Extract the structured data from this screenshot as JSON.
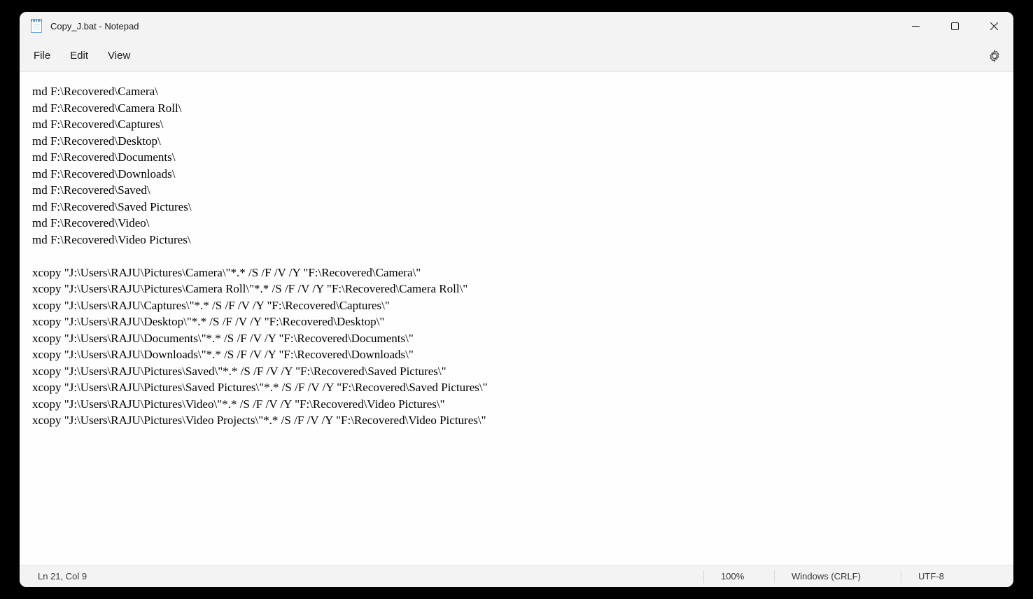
{
  "window": {
    "title": "Copy_J.bat - Notepad"
  },
  "menu": {
    "file": "File",
    "edit": "Edit",
    "view": "View"
  },
  "editor": {
    "content": "md F:\\Recovered\\Camera\\\nmd F:\\Recovered\\Camera Roll\\\nmd F:\\Recovered\\Captures\\\nmd F:\\Recovered\\Desktop\\\nmd F:\\Recovered\\Documents\\\nmd F:\\Recovered\\Downloads\\\nmd F:\\Recovered\\Saved\\\nmd F:\\Recovered\\Saved Pictures\\\nmd F:\\Recovered\\Video\\\nmd F:\\Recovered\\Video Pictures\\\n\nxcopy \"J:\\Users\\RAJU\\Pictures\\Camera\\\"*.* /S /F /V /Y \"F:\\Recovered\\Camera\\\"\nxcopy \"J:\\Users\\RAJU\\Pictures\\Camera Roll\\\"*.* /S /F /V /Y \"F:\\Recovered\\Camera Roll\\\"\nxcopy \"J:\\Users\\RAJU\\Captures\\\"*.* /S /F /V /Y \"F:\\Recovered\\Captures\\\"\nxcopy \"J:\\Users\\RAJU\\Desktop\\\"*.* /S /F /V /Y \"F:\\Recovered\\Desktop\\\"\nxcopy \"J:\\Users\\RAJU\\Documents\\\"*.* /S /F /V /Y \"F:\\Recovered\\Documents\\\"\nxcopy \"J:\\Users\\RAJU\\Downloads\\\"*.* /S /F /V /Y \"F:\\Recovered\\Downloads\\\"\nxcopy \"J:\\Users\\RAJU\\Pictures\\Saved\\\"*.* /S /F /V /Y \"F:\\Recovered\\Saved Pictures\\\"\nxcopy \"J:\\Users\\RAJU\\Pictures\\Saved Pictures\\\"*.* /S /F /V /Y \"F:\\Recovered\\Saved Pictures\\\"\nxcopy \"J:\\Users\\RAJU\\Pictures\\Video\\\"*.* /S /F /V /Y \"F:\\Recovered\\Video Pictures\\\"\nxcopy \"J:\\Users\\RAJU\\Pictures\\Video Projects\\\"*.* /S /F /V /Y \"F:\\Recovered\\Video Pictures\\\""
  },
  "status": {
    "cursor": "Ln 21, Col 9",
    "zoom": "100%",
    "eol": "Windows (CRLF)",
    "encoding": "UTF-8"
  }
}
